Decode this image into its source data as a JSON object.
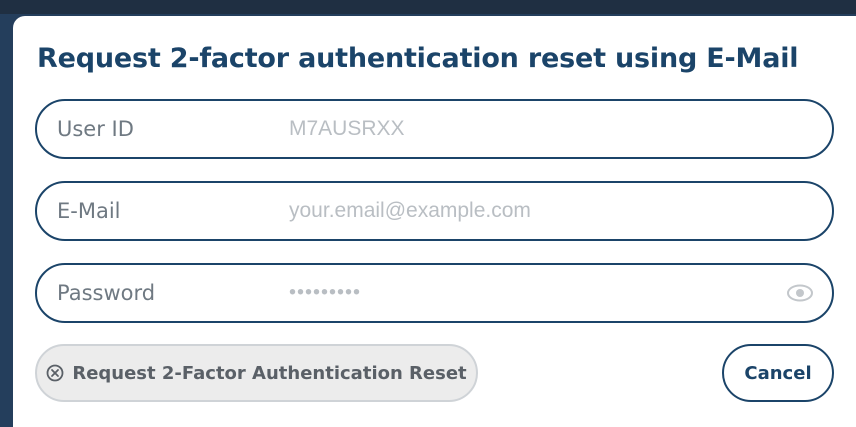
{
  "dialog": {
    "title": "Request 2-factor authentication reset using E-Mail"
  },
  "fields": {
    "user_id": {
      "label": "User ID",
      "value": "",
      "placeholder": "M7AUSRXX"
    },
    "email": {
      "label": "E-Mail",
      "value": "",
      "placeholder": "your.email@example.com"
    },
    "password": {
      "label": "Password",
      "value": "",
      "placeholder": "•••••••••",
      "toggle_icon": "eye-icon"
    }
  },
  "actions": {
    "reset_label": "Request 2-Factor Authentication Reset",
    "reset_icon": "cancel-circle-icon",
    "reset_enabled": false,
    "cancel_label": "Cancel"
  },
  "colors": {
    "primary": "#1b4469",
    "backdrop": "#243e5c",
    "placeholder": "#b9bec3",
    "label": "#6f7982",
    "disabled_bg": "#ececec"
  }
}
